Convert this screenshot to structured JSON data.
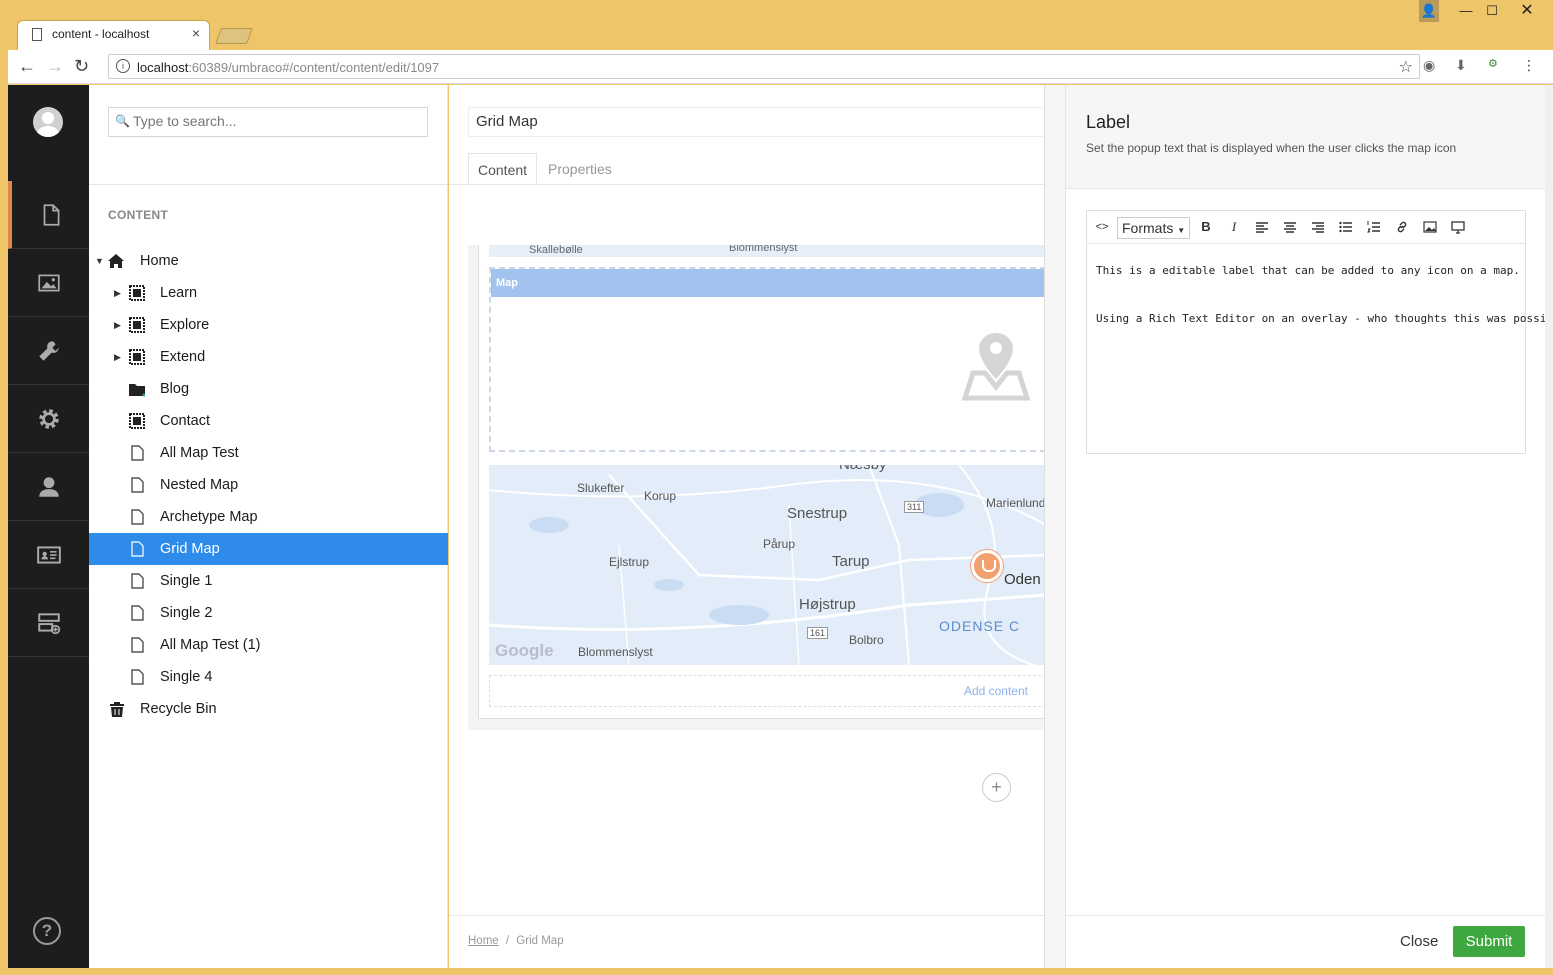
{
  "browser": {
    "tab_title": "content - localhost",
    "tab_close": "×",
    "url_host": "localhost",
    "url_rest": ":60389/umbraco#/content/content/edit/1097"
  },
  "search": {
    "placeholder": "Type to search..."
  },
  "tree": {
    "section_title": "CONTENT",
    "items": [
      {
        "label": "Home"
      },
      {
        "label": "Learn"
      },
      {
        "label": "Explore"
      },
      {
        "label": "Extend"
      },
      {
        "label": "Blog"
      },
      {
        "label": "Contact"
      },
      {
        "label": "All Map Test"
      },
      {
        "label": "Nested Map"
      },
      {
        "label": "Archetype Map"
      },
      {
        "label": "Grid Map"
      },
      {
        "label": "Single 1"
      },
      {
        "label": "Single 2"
      },
      {
        "label": "All Map Test (1)"
      },
      {
        "label": "Single 4"
      },
      {
        "label": "Recycle Bin"
      }
    ]
  },
  "editor": {
    "doc_name": "Grid Map",
    "tabs": [
      "Content",
      "Properties"
    ],
    "map_cell_header": "Map",
    "add_content": "Add content",
    "map_labels": {
      "top_strip_1": "Skallebølle",
      "top_strip_2": "Blommenslyst",
      "naesby": "Næsby",
      "slukefter": "Slukefter",
      "korup": "Korup",
      "snestrup": "Snestrup",
      "marienlund": "Marienlund",
      "purup": "Pårup",
      "ejlstrup": "Ejlstrup",
      "tarup": "Tarup",
      "odense": "Oden",
      "hojstrup": "Højstrup",
      "odense_c": "ODENSE C",
      "bolbro": "Bolbro",
      "blommenslyst": "Blommenslyst",
      "google": "Google",
      "road_311": "311",
      "road_161": "161"
    },
    "plus": "+",
    "breadcrumb": {
      "home": "Home",
      "sep": "/",
      "current": "Grid Map"
    }
  },
  "overlay": {
    "title": "Label",
    "description": "Set the popup text that is displayed when the user clicks the map icon",
    "toolbar": {
      "source": "<>",
      "formats": "Formats",
      "bold": "B",
      "italic": "I"
    },
    "content": [
      "This is a editable label that can be added to any icon on a map.",
      "Using a Rich Text Editor on an overlay - who thoughts this was possible"
    ],
    "close_label": "Close",
    "submit_label": "Submit"
  },
  "colors": {
    "accent": "#e2874c",
    "selected": "#2e8bea",
    "submit": "#3fa73f",
    "chrome": "#efc56a"
  }
}
